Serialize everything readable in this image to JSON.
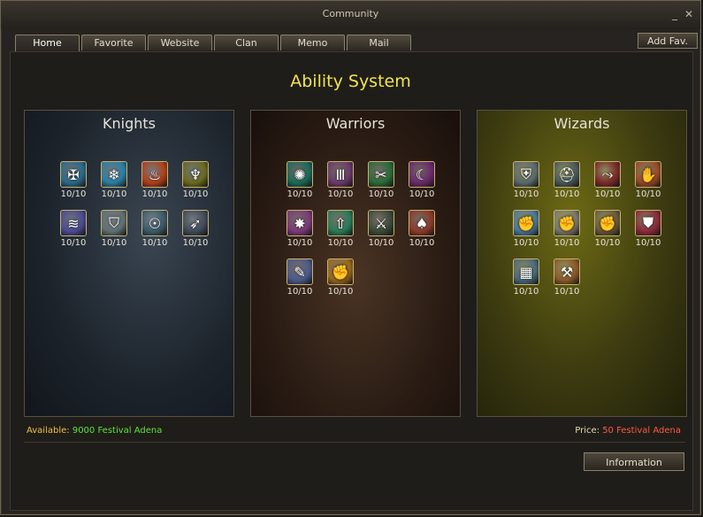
{
  "window": {
    "title": "Community",
    "minimize_icon": "minimize-icon",
    "close_icon": "close-icon"
  },
  "tabs": [
    {
      "label": "Home",
      "active": true
    },
    {
      "label": "Favorite",
      "active": false
    },
    {
      "label": "Website",
      "active": false
    },
    {
      "label": "Clan",
      "active": false
    },
    {
      "label": "Memo",
      "active": false
    },
    {
      "label": "Mail",
      "active": false
    }
  ],
  "add_fav_label": "Add Fav.",
  "page_heading": "Ability System",
  "panels": [
    {
      "title": "Knights",
      "skills": [
        {
          "icon": "shield-cross-icon",
          "level": "10/10",
          "color": "#2a6a8a",
          "glyph": "✠"
        },
        {
          "icon": "ice-shield-icon",
          "level": "10/10",
          "color": "#2a7fa0",
          "glyph": "❄"
        },
        {
          "icon": "fire-wave-icon",
          "level": "10/10",
          "color": "#b0401a",
          "glyph": "♨"
        },
        {
          "icon": "golden-wings-icon",
          "level": "10/10",
          "color": "#6a6a20",
          "glyph": "♆"
        },
        {
          "icon": "claw-slash-icon",
          "level": "10/10",
          "color": "#4a4a90",
          "glyph": "≋"
        },
        {
          "icon": "helmet-icon",
          "level": "10/10",
          "color": "#607070",
          "glyph": "⛉"
        },
        {
          "icon": "mask-icon",
          "level": "10/10",
          "color": "#3a5a6a",
          "glyph": "☉"
        },
        {
          "icon": "spear-icon",
          "level": "10/10",
          "color": "#404a5a",
          "glyph": "➶"
        }
      ]
    },
    {
      "title": "Warriors",
      "skills": [
        {
          "icon": "whirlwind-icon",
          "level": "10/10",
          "color": "#1a6a5a",
          "glyph": "✺"
        },
        {
          "icon": "rune-pillar-icon",
          "level": "10/10",
          "color": "#6a3a6a",
          "glyph": "Ⅲ"
        },
        {
          "icon": "double-blade-icon",
          "level": "10/10",
          "color": "#2a6a3a",
          "glyph": "✂"
        },
        {
          "icon": "crescent-slash-icon",
          "level": "10/10",
          "color": "#6a2a6a",
          "glyph": "☾"
        },
        {
          "icon": "war-cry-icon",
          "level": "10/10",
          "color": "#7a3a7a",
          "glyph": "✸"
        },
        {
          "icon": "piercing-arrow-icon",
          "level": "10/10",
          "color": "#2a7a5a",
          "glyph": "⇧"
        },
        {
          "icon": "chain-strike-icon",
          "level": "10/10",
          "color": "#3a4a3a",
          "glyph": "⚔"
        },
        {
          "icon": "flame-blade-icon",
          "level": "10/10",
          "color": "#8a3a2a",
          "glyph": "♠"
        },
        {
          "icon": "scroll-icon",
          "level": "10/10",
          "color": "#4a5a8a",
          "glyph": "✎"
        },
        {
          "icon": "golden-fist-icon",
          "level": "10/10",
          "color": "#9a6a1a",
          "glyph": "✊"
        }
      ]
    },
    {
      "title": "Wizards",
      "skills": [
        {
          "icon": "armor-icon",
          "level": "10/10",
          "color": "#5a6a6a",
          "glyph": "⛨"
        },
        {
          "icon": "steel-helm-icon",
          "level": "10/10",
          "color": "#4a5a5a",
          "glyph": "⛑"
        },
        {
          "icon": "boot-icon",
          "level": "10/10",
          "color": "#7a2a2a",
          "glyph": "⤳"
        },
        {
          "icon": "gauntlet-icon",
          "level": "10/10",
          "color": "#9a4a2a",
          "glyph": "✋"
        },
        {
          "icon": "raised-fist-icon",
          "level": "10/10",
          "color": "#4a7a9a",
          "glyph": "✊"
        },
        {
          "icon": "power-fist-icon",
          "level": "10/10",
          "color": "#7a7a6a",
          "glyph": "✊"
        },
        {
          "icon": "iron-fist-icon",
          "level": "10/10",
          "color": "#6a5a3a",
          "glyph": "✊"
        },
        {
          "icon": "red-shield-icon",
          "level": "10/10",
          "color": "#8a2a3a",
          "glyph": "⛊"
        },
        {
          "icon": "wall-icon",
          "level": "10/10",
          "color": "#4a6a7a",
          "glyph": "▦"
        },
        {
          "icon": "hammer-icon",
          "level": "10/10",
          "color": "#8a5a2a",
          "glyph": "⚒"
        }
      ]
    }
  ],
  "footer": {
    "available_label": "Available:",
    "available_value": "9000 Festival Adena",
    "price_label": "Price:",
    "price_value": "50 Festival Adena"
  },
  "information_button": "Information"
}
